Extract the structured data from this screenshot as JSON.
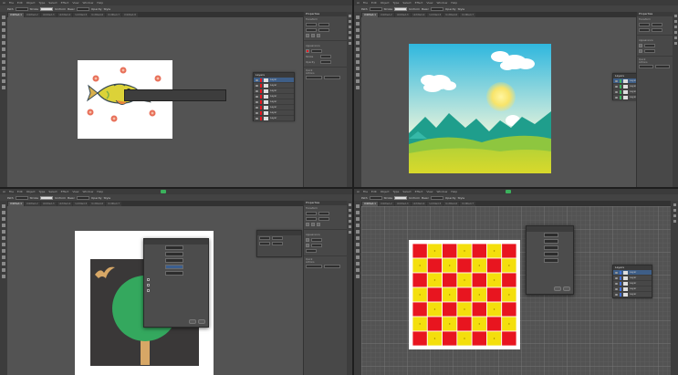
{
  "quadrants": [
    {
      "menu": [
        "Ai",
        "File",
        "Edit",
        "Object",
        "Type",
        "Select",
        "Effect",
        "View",
        "Window",
        "Help"
      ],
      "menu_badge": "",
      "control": [
        "Path",
        "Stroke",
        "Uniform",
        "Basic",
        "Opacity",
        "Style"
      ],
      "tabs": [
        "Untitled-1",
        "Untitled-2",
        "Untitled-3",
        "Untitled-4",
        "Untitled-5",
        "Untitled-6",
        "Untitled-7",
        "Untitled-8"
      ],
      "tooltip": "",
      "layers_panel": {
        "title": "Layers",
        "rows": [
          "Layer",
          "Layer",
          "Layer",
          "Layer",
          "Layer",
          "Layer",
          "Layer",
          "Layer"
        ]
      },
      "properties_panel": {
        "title": "Properties",
        "sections": [
          "Transform",
          "Appearance",
          "Stroke",
          "Opacity",
          "Quick Actions"
        ]
      }
    },
    {
      "menu": [
        "Ai",
        "File",
        "Edit",
        "Object",
        "Type",
        "Select",
        "Effect",
        "View",
        "Window",
        "Help"
      ],
      "menu_badge": "",
      "control": [
        "Path",
        "Stroke",
        "Uniform",
        "Basic",
        "Opacity",
        "Style"
      ],
      "tabs": [
        "Untitled-1",
        "Untitled-2",
        "Untitled-3",
        "Untitled-4",
        "Untitled-5",
        "Untitled-6",
        "Untitled-7"
      ],
      "layers_panel": {
        "title": "Layers",
        "rows": [
          "Layer",
          "Layer",
          "Layer",
          "Layer"
        ]
      },
      "properties_panel": {
        "title": "Properties",
        "sections": [
          "Transform",
          "Appearance",
          "Quick Actions"
        ]
      }
    },
    {
      "menu": [
        "Ai",
        "File",
        "Edit",
        "Object",
        "Type",
        "Select",
        "Effect",
        "View",
        "Window",
        "Help"
      ],
      "menu_badge": "",
      "control": [
        "Path",
        "Stroke",
        "Uniform",
        "Basic",
        "Opacity",
        "Style"
      ],
      "tabs": [
        "Untitled-1",
        "Untitled-2",
        "Untitled-3",
        "Untitled-4",
        "Untitled-5",
        "Untitled-6",
        "Untitled-7"
      ],
      "dialog": {
        "title": "",
        "rows": [
          {
            "label": "",
            "value": ""
          },
          {
            "label": "",
            "value": ""
          },
          {
            "label": "",
            "value": ""
          },
          {
            "label": "",
            "value": ""
          },
          {
            "label": "",
            "value": ""
          }
        ],
        "checks": [
          "",
          "",
          ""
        ],
        "ok": "",
        "cancel": ""
      },
      "properties_panel": {
        "title": "Properties",
        "sections": [
          "Transform",
          "Appearance",
          "Quick Actions"
        ]
      }
    },
    {
      "menu": [
        "Ai",
        "File",
        "Edit",
        "Object",
        "Type",
        "Select",
        "Effect",
        "View",
        "Window",
        "Help"
      ],
      "menu_badge": "",
      "control": [
        "Path",
        "Stroke",
        "Uniform",
        "Basic",
        "Opacity",
        "Style"
      ],
      "tabs": [
        "Untitled-1",
        "Untitled-2",
        "Untitled-3",
        "Untitled-4",
        "Untitled-5",
        "Untitled-6",
        "Untitled-7"
      ],
      "dialog": {
        "title": "",
        "rows": [
          {
            "label": "",
            "value": ""
          },
          {
            "label": "",
            "value": ""
          },
          {
            "label": "",
            "value": ""
          },
          {
            "label": "",
            "value": ""
          },
          {
            "label": "",
            "value": ""
          }
        ],
        "ok": "",
        "cancel": ""
      },
      "layers_panel": {
        "title": "Layers",
        "rows": [
          "Layer",
          "Layer",
          "Layer",
          "Layer",
          "Layer"
        ]
      }
    }
  ],
  "colors": {
    "canvas_bg": "#535353",
    "artboard": "#ffffff",
    "accent_green": "#3bb15c",
    "check_red": "#e8151f",
    "check_yellow": "#f4df0c",
    "tree_green": "#34a85e",
    "trunk": "#d7a766",
    "dark_bg": "#3a3838",
    "sky_top": "#2fb7de",
    "sky_bottom": "#f2f7dc",
    "mountain": "#1f9e8c",
    "hill_green": "#8ec63f",
    "field": "#c7d42f"
  },
  "icons": [
    "fish-artwork",
    "flower-icon",
    "sun-icon",
    "cloud-icon",
    "bird-icon",
    "tree-artwork",
    "checkerboard-artwork",
    "eye-icon",
    "layer-thumbnail"
  ]
}
